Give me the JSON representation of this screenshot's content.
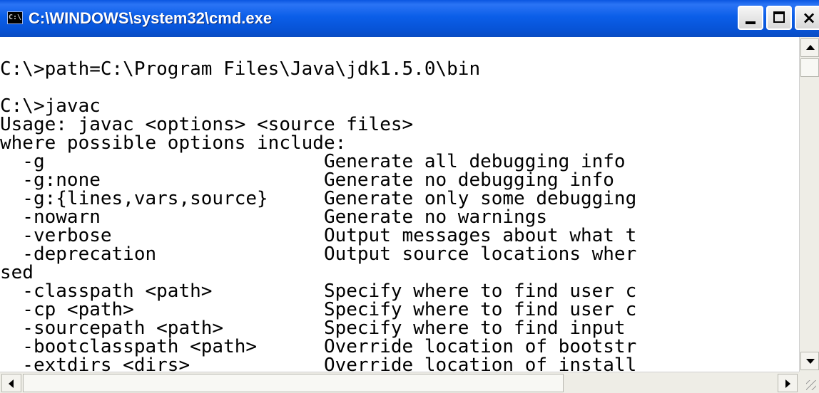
{
  "window": {
    "title": "C:\\WINDOWS\\system32\\cmd.exe",
    "icon": "cmd-icon",
    "icon_label": "C:\\"
  },
  "console": {
    "lines": [
      "",
      "C:\\>path=C:\\Program Files\\Java\\jdk1.5.0\\bin",
      "",
      "C:\\>javac",
      "Usage: javac <options> <source files>",
      "where possible options include:",
      "  -g                         Generate all debugging info",
      "  -g:none                    Generate no debugging info",
      "  -g:{lines,vars,source}     Generate only some debugging",
      "  -nowarn                    Generate no warnings",
      "  -verbose                   Output messages about what t",
      "  -deprecation               Output source locations wher",
      "sed",
      "  -classpath <path>          Specify where to find user c",
      "  -cp <path>                 Specify where to find user c",
      "  -sourcepath <path>         Specify where to find input",
      "  -bootclasspath <path>      Override location of bootstr",
      "  -extdirs <dirs>            Override location of install"
    ]
  },
  "colors": {
    "titlebar": "#0a56e0",
    "console_bg": "#ffffff",
    "console_text": "#000000"
  }
}
